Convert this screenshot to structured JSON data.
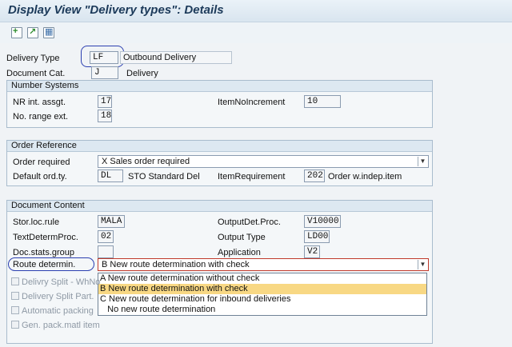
{
  "header": {
    "title": "Display View \"Delivery types\": Details"
  },
  "toolbar": {
    "icons": [
      "new-entry-icon",
      "copy-entry-icon",
      "details-icon"
    ]
  },
  "top": {
    "delivery_type_label": "Delivery Type",
    "delivery_type_value": "LF",
    "delivery_type_desc": "Outbound Delivery",
    "doc_cat_label": "Document Cat.",
    "doc_cat_value": "J",
    "doc_cat_desc": "Delivery"
  },
  "number_systems": {
    "title": "Number Systems",
    "nr_int_label": "NR int. assgt.",
    "nr_int_value": "17",
    "no_range_ext_label": "No. range ext.",
    "no_range_ext_value": "18",
    "item_no_inc_label": "ItemNoIncrement",
    "item_no_inc_value": "10"
  },
  "order_reference": {
    "title": "Order Reference",
    "order_required_label": "Order required",
    "order_required_value": "X Sales order required",
    "default_ordty_label": "Default ord.ty.",
    "default_ordty_value": "DL",
    "default_ordty_desc": "STO Standard Del",
    "item_req_label": "ItemRequirement",
    "item_req_value": "202",
    "item_req_desc": "Order w.indep.item"
  },
  "document_content": {
    "title": "Document Content",
    "stor_loc_label": "Stor.loc.rule",
    "stor_loc_value": "MALA",
    "text_determ_label": "TextDetermProc.",
    "text_determ_value": "02",
    "doc_stats_label": "Doc.stats.group",
    "doc_stats_value": "",
    "output_det_label": "OutputDet.Proc.",
    "output_det_value": "V10000",
    "output_type_label": "Output Type",
    "output_type_value": "LD00",
    "application_label": "Application",
    "application_value": "V2",
    "route_label": "Route determin.",
    "route_value": "B New route determination with check",
    "route_options": [
      "A New route determination without check",
      "B New route determination with check",
      "C New route determination for inbound deliveries",
      "   No new route determination"
    ],
    "checkboxes": [
      "Delivry Split - WhNo",
      "Delivery Split Part.",
      "Automatic packing",
      "Gen. pack.matl item"
    ]
  }
}
